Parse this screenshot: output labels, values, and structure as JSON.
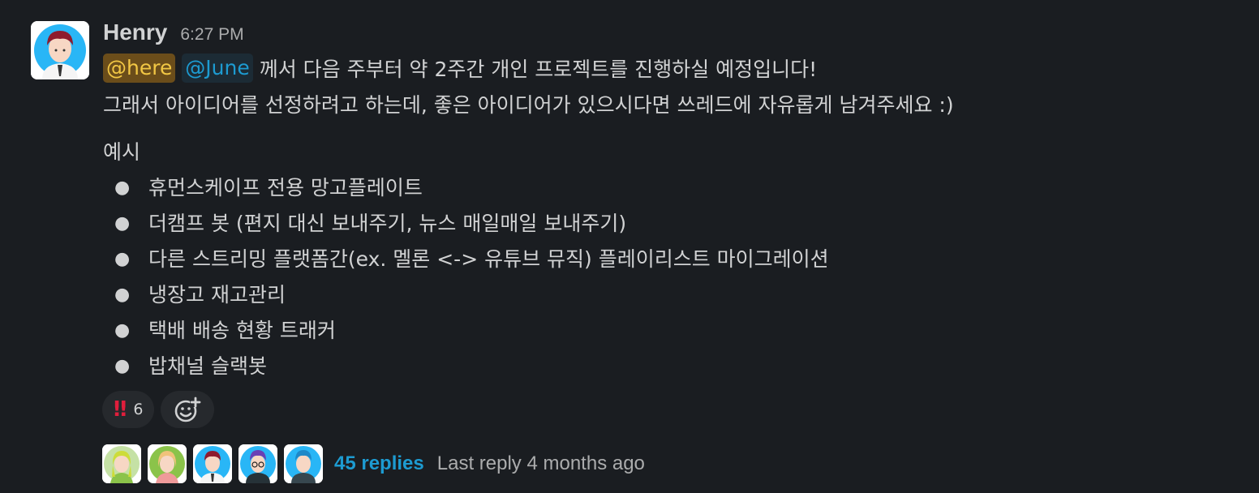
{
  "message": {
    "author": "Henry",
    "timestamp": "6:27 PM",
    "mentions": {
      "here": "@here",
      "user": "@June"
    },
    "line1_rest": " 께서 다음 주부터 약 2주간 개인 프로젝트를 진행하실 예정입니다!",
    "line2": "그래서 아이디어를 선정하려고 하는데, 좋은 아이디어가 있으시다면 쓰레드에 자유롭게 남겨주세요 :)",
    "example_heading": "예시",
    "bullet_char": "●",
    "examples": [
      "휴먼스케이프 전용 망고플레이트",
      "더캠프 봇 (편지 대신 보내주기, 뉴스 매일매일 보내주기)",
      "다른 스트리밍 플랫폼간(ex. 멜론 <-> 유튜브 뮤직) 플레이리스트 마이그레이션",
      "냉장고 재고관리",
      "택배 배송 현황 트래커",
      "밥채널 슬랙봇"
    ]
  },
  "reactions": [
    {
      "emoji_icon": "double-exclamation-icon",
      "emoji": "‼",
      "count": "6"
    }
  ],
  "add_reaction_icon": "add-emoji-icon",
  "thread": {
    "participant_icons": [
      "avatar-green-hair",
      "avatar-blonde-hair",
      "avatar-henry",
      "avatar-purple-hair",
      "avatar-teal-hair"
    ],
    "replies": "45 replies",
    "last_reply": "Last reply 4 months ago"
  },
  "colors": {
    "background": "#1a1d21",
    "link": "#1d9bd1",
    "here_mention_bg": "#6b4d1a",
    "here_mention_fg": "#f2c744",
    "reaction_emoji": "#e01e3c"
  }
}
